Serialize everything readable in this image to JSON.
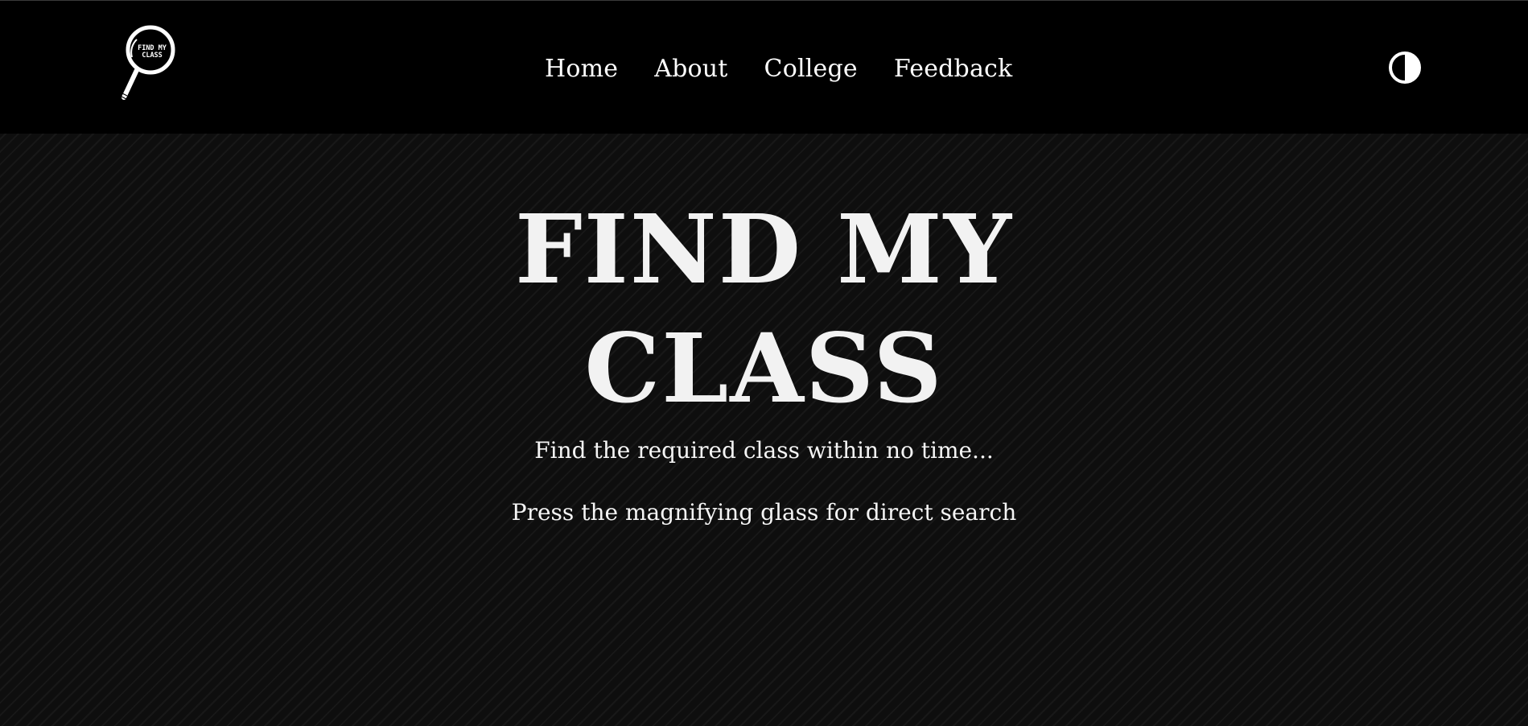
{
  "header": {
    "logo": {
      "icon": "magnifying-glass-logo",
      "text_line1": "FIND MY",
      "text_line2": "CLASS"
    },
    "nav": [
      {
        "label": "Home"
      },
      {
        "label": "About"
      },
      {
        "label": "College"
      },
      {
        "label": "Feedback"
      }
    ],
    "theme_toggle_icon": "contrast-half-circle-icon"
  },
  "hero": {
    "title_line1": "FIND MY",
    "title_line2": "CLASS",
    "subtitle": "Find the required class within no time...",
    "instruction": "Press the magnifying glass for direct search"
  },
  "colors": {
    "navbar_bg": "#000000",
    "hero_bg": "#0f0f0f",
    "text": "#ffffff"
  }
}
